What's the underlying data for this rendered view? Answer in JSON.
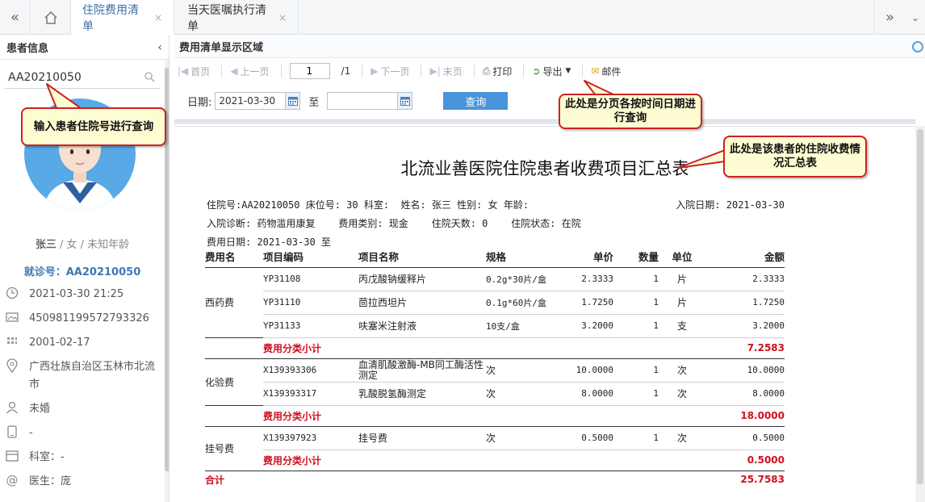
{
  "tabs": {
    "items": [
      {
        "label": "住院费用清单",
        "active": true
      },
      {
        "label": "当天医嘱执行清单",
        "active": false
      }
    ],
    "close_glyph": "×"
  },
  "patient_panel": {
    "title": "患者信息",
    "search_value": "AA20210050",
    "name": "张三",
    "sex_age": " / 女 / 未知年龄",
    "visit_no": "就诊号：AA20210050",
    "rows": [
      {
        "icon": "clock-icon",
        "text": "2021-03-30 21:25"
      },
      {
        "icon": "id-card-icon",
        "text": "450981199572793326"
      },
      {
        "icon": "calendar-icon",
        "text": "2001-02-17"
      },
      {
        "icon": "location-icon",
        "text": "广西壮族自治区玉林市北流市"
      },
      {
        "icon": "user-icon",
        "text": "未婚"
      },
      {
        "icon": "phone-icon",
        "text": "-"
      },
      {
        "icon": "department-icon",
        "text": "科室：-"
      },
      {
        "icon": "doctor-icon",
        "text": "医生：庞"
      }
    ]
  },
  "main": {
    "title": "费用清单显示区域",
    "toolbar": {
      "first": "首页",
      "prev": "上一页",
      "page_value": "1",
      "page_total": "/1",
      "next": "下一页",
      "last": "末页",
      "print": "打印",
      "export": "导出",
      "mail": "邮件"
    },
    "filter": {
      "date_label": "日期:",
      "from": "2021-03-30",
      "to_label": "至",
      "to": "",
      "query": "查询"
    }
  },
  "report": {
    "title": "北流业善医院住院患者收费项目汇总表",
    "line1": "住院号:AA20210050 床位号: 30 科室:  姓名: 张三 性别: 女 年龄:",
    "admit_date": "入院日期: 2021-03-30",
    "line2": "入院诊断: 药物滥用康复    费用类别: 现金    住院天数: 0    住院状态: 在院",
    "line3": "费用日期: 2021-03-30 至",
    "headers": [
      "费用名",
      "项目编码",
      "项目名称",
      "规格",
      "单价",
      "数量",
      "单位",
      "金额"
    ],
    "groups": [
      {
        "category": "西药费",
        "items": [
          {
            "code": "YP31108",
            "name": "丙戊酸钠缓释片",
            "spec": "0.2g*30片/盒",
            "price": "2.3333",
            "qty": "1",
            "unit": "片",
            "amount": "2.3333"
          },
          {
            "code": "YP31110",
            "name": "茴拉西坦片",
            "spec": "0.1g*60片/盒",
            "price": "1.7250",
            "qty": "1",
            "unit": "片",
            "amount": "1.7250"
          },
          {
            "code": "YP31133",
            "name": "呋塞米注射液",
            "spec": "10支/盒",
            "price": "3.2000",
            "qty": "1",
            "unit": "支",
            "amount": "3.2000"
          }
        ],
        "subtotal_label": "费用分类小计",
        "subtotal": "7.2583"
      },
      {
        "category": "化验费",
        "items": [
          {
            "code": "X139393306",
            "name": "血清肌酸激酶-MB同工酶活性测定",
            "spec": "次",
            "price": "10.0000",
            "qty": "1",
            "unit": "次",
            "amount": "10.0000"
          },
          {
            "code": "X139393317",
            "name": "乳酸脱氢酶测定",
            "spec": "次",
            "price": "8.0000",
            "qty": "1",
            "unit": "次",
            "amount": "8.0000"
          }
        ],
        "subtotal_label": "费用分类小计",
        "subtotal": "18.0000"
      },
      {
        "category": "挂号费",
        "items": [
          {
            "code": "X139397923",
            "name": "挂号费",
            "spec": "次",
            "price": "0.5000",
            "qty": "1",
            "unit": "次",
            "amount": "0.5000"
          }
        ],
        "subtotal_label": "费用分类小计",
        "subtotal": "0.5000"
      }
    ],
    "total_label": "合计",
    "total": "25.7583"
  },
  "annotations": {
    "search_hint": "输入患者住院号进行查询",
    "page_hint": "此处是分页各按时间日期进行查询",
    "report_hint": "此处是该患者的住院收费情况汇总表"
  },
  "colors": {
    "accent": "#3d78b5",
    "query_button": "#4a94dc",
    "subtotal_red": "#d0101f",
    "callout_border": "#cc2222",
    "callout_bg": "#fefcd2"
  }
}
